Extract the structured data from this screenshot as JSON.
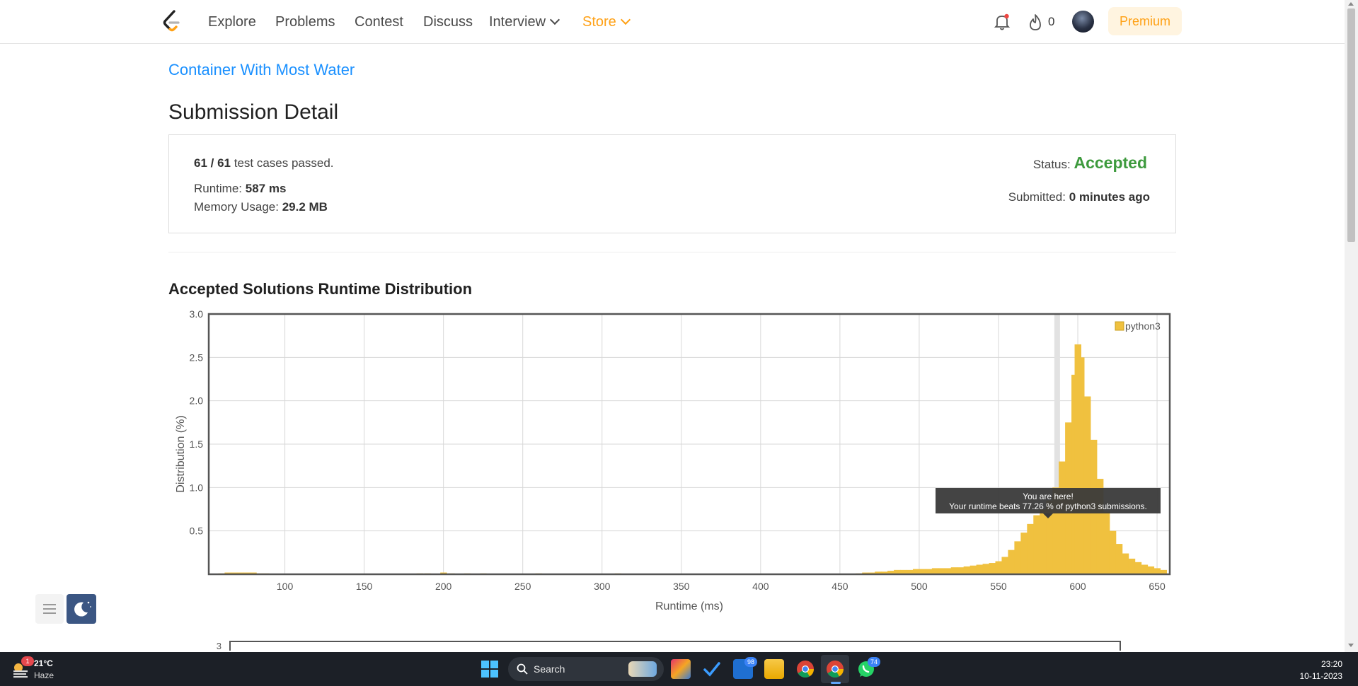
{
  "nav": {
    "items": [
      "Explore",
      "Problems",
      "Contest",
      "Discuss"
    ],
    "interview": "Interview",
    "store": "Store",
    "fire_count": "0",
    "premium": "Premium"
  },
  "problem": {
    "title": "Container With Most Water"
  },
  "page": {
    "title": "Submission Detail"
  },
  "submission": {
    "passed": "61 / 61",
    "passed_suffix": " test cases passed.",
    "runtime_label": "Runtime: ",
    "runtime": "587 ms",
    "memory_label": "Memory Usage: ",
    "memory": "29.2 MB",
    "status_label": "Status: ",
    "status": "Accepted",
    "submitted_label": "Submitted: ",
    "submitted": "0 minutes ago"
  },
  "section": {
    "title": "Accepted Solutions Runtime Distribution"
  },
  "chart_data": {
    "type": "bar",
    "title": "",
    "xlabel": "Runtime (ms)",
    "ylabel": "Distribution (%)",
    "xlim": [
      52,
      658
    ],
    "ylim": [
      0,
      3.0
    ],
    "xticks": [
      100,
      150,
      200,
      250,
      300,
      350,
      400,
      450,
      500,
      550,
      600,
      650
    ],
    "yticks": [
      0.5,
      1.0,
      1.5,
      2.0,
      2.5,
      3.0
    ],
    "ytick_labels": [
      "0.5",
      "1.0",
      "1.5",
      "2.0",
      "2.5",
      "3.0"
    ],
    "grid": true,
    "legend": "top-right",
    "series": [
      {
        "name": "python3",
        "color": "#f0c13f",
        "x": [
          60,
          64,
          68,
          72,
          76,
          80,
          84,
          88,
          185,
          190,
          200,
          205,
          215,
          225,
          260,
          310,
          462,
          466,
          470,
          474,
          478,
          482,
          486,
          490,
          494,
          498,
          502,
          506,
          510,
          514,
          518,
          522,
          526,
          530,
          534,
          538,
          542,
          546,
          550,
          554,
          558,
          562,
          566,
          570,
          574,
          578,
          582,
          586,
          590,
          594,
          598,
          600,
          602,
          606,
          610,
          614,
          618,
          622,
          626,
          630,
          634,
          638,
          642,
          646,
          650,
          654
        ],
        "values": [
          0.01,
          0.02,
          0.02,
          0.02,
          0.02,
          0.02,
          0.01,
          0.01,
          0.01,
          0.01,
          0.02,
          0.01,
          0.01,
          0.01,
          0.01,
          0.01,
          0.01,
          0.02,
          0.02,
          0.03,
          0.03,
          0.04,
          0.05,
          0.05,
          0.05,
          0.06,
          0.06,
          0.06,
          0.07,
          0.07,
          0.07,
          0.08,
          0.08,
          0.09,
          0.1,
          0.11,
          0.12,
          0.13,
          0.15,
          0.2,
          0.28,
          0.38,
          0.48,
          0.58,
          0.68,
          0.75,
          0.85,
          1.0,
          1.3,
          1.75,
          2.3,
          2.65,
          2.5,
          2.05,
          1.55,
          1.1,
          0.72,
          0.5,
          0.35,
          0.24,
          0.18,
          0.14,
          0.11,
          0.09,
          0.07,
          0.05
        ]
      }
    ],
    "highlight_x": 587,
    "tooltip": [
      "You are here!",
      "Your runtime beats 77.26 % of python3 submissions."
    ],
    "second_chart_ytick": "3"
  },
  "taskbar": {
    "temp": "21°C",
    "weather": "Haze",
    "weather_badge": "1",
    "search": "Search",
    "badge_a": "98",
    "badge_b": "74",
    "time": "23:20",
    "date": "10-11-2023"
  }
}
